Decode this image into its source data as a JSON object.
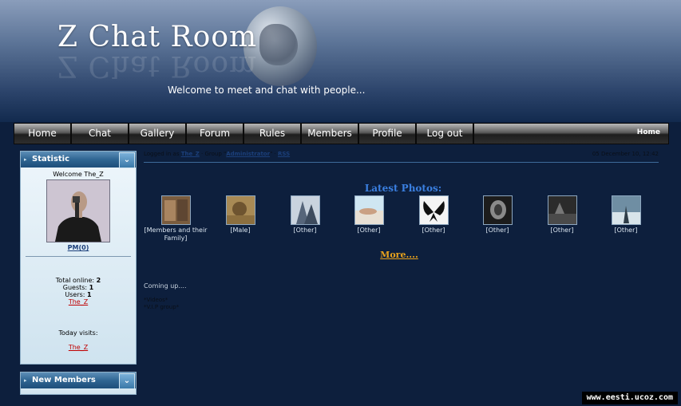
{
  "header": {
    "site_title": "Z Chat Room",
    "tagline": "Welcome to meet and chat with people..."
  },
  "nav": {
    "items": [
      "Home",
      "Chat",
      "Gallery",
      "Forum",
      "Rules",
      "Members",
      "Profile",
      "Log out"
    ],
    "right_label": "Home"
  },
  "sidebar": {
    "statistic": {
      "title": "Statistic",
      "welcome": "Welcome The_Z",
      "pm_link": "PM(0)",
      "total_online_label": "Total online:",
      "total_online": "2",
      "guests_label": "Guests:",
      "guests": "1",
      "users_label": "Users:",
      "users": "1",
      "online_user": "The_Z",
      "today_visits_label": "Today visits:",
      "today_user": "The_Z"
    },
    "new_members": {
      "title": "New Members"
    }
  },
  "main": {
    "logged_prefix": "Logged in as",
    "user": "The_Z",
    "group_prefix": "· Group \"",
    "group": "Administrator",
    "group_suffix": "\" ·",
    "rss": "RSS",
    "date": "05 December 10, 12:42",
    "latest_title": "Latest Photos:",
    "photos": [
      {
        "caption": "[Members and their Family]"
      },
      {
        "caption": "[Male]"
      },
      {
        "caption": "[Other]"
      },
      {
        "caption": "[Other]"
      },
      {
        "caption": "[Other]"
      },
      {
        "caption": "[Other]"
      },
      {
        "caption": "[Other]"
      },
      {
        "caption": "[Other]"
      }
    ],
    "more_link": "More....",
    "coming_up": "Coming up....",
    "upcoming": [
      "*Videos*",
      "*V.I.P group*"
    ]
  },
  "watermark": "www.eesti.ucoz.com",
  "colors": {
    "page_background": "#0d1f3d",
    "latest_title": "#3a7fe0",
    "more_link": "#e8a21c",
    "user_link": "#c00000"
  }
}
